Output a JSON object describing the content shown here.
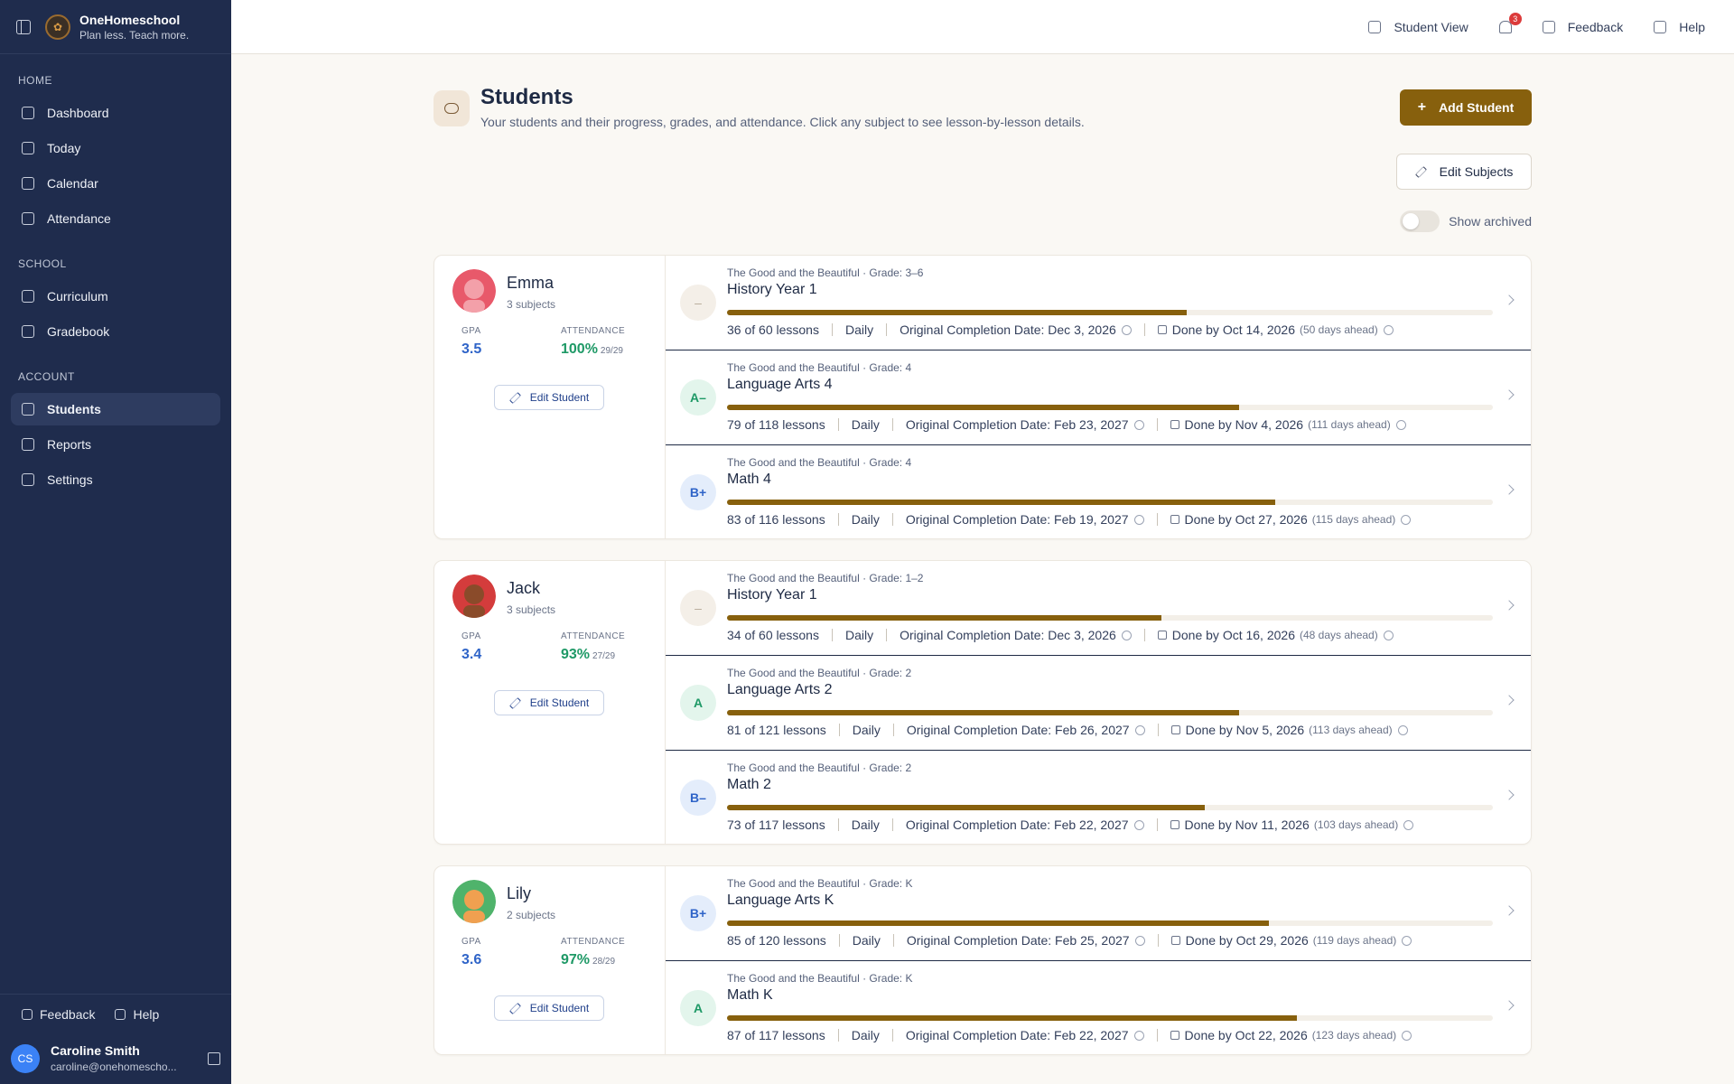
{
  "brand": {
    "name": "OneHomeschool",
    "tagline": "Plan less. Teach more."
  },
  "nav": {
    "home_title": "HOME",
    "home": [
      {
        "label": "Dashboard"
      },
      {
        "label": "Today"
      },
      {
        "label": "Calendar"
      },
      {
        "label": "Attendance"
      }
    ],
    "school_title": "SCHOOL",
    "school": [
      {
        "label": "Curriculum"
      },
      {
        "label": "Gradebook"
      }
    ],
    "account_title": "ACCOUNT",
    "account": [
      {
        "label": "Students"
      },
      {
        "label": "Reports"
      },
      {
        "label": "Settings"
      }
    ]
  },
  "sidebar_footer": {
    "feedback": "Feedback",
    "help": "Help"
  },
  "user": {
    "initials": "CS",
    "name": "Caroline Smith",
    "email": "caroline@onehomescho..."
  },
  "topbar": {
    "student_view": "Student View",
    "notif_count": "3",
    "feedback": "Feedback",
    "help": "Help"
  },
  "page": {
    "title": "Students",
    "subtitle": "Your students and their progress, grades, and attendance. Click any subject to see lesson-by-lesson details.",
    "add_student": "Add Student",
    "edit_subjects": "Edit Subjects",
    "show_archived": "Show archived",
    "gpa_label": "GPA",
    "attendance_label": "ATTENDANCE",
    "edit_student": "Edit Student"
  },
  "students": [
    {
      "name": "Emma",
      "subjects_count": "3 subjects",
      "gpa": "3.5",
      "attendance": "100%",
      "attendance_days": "29/29",
      "subjects": [
        {
          "meta": "The Good and the Beautiful · Grade: 3–6",
          "title": "History Year 1",
          "grade": "–",
          "progress": 0.6,
          "lessons": "36 of 60 lessons",
          "freq": "Daily",
          "orig": "Original Completion Date: Dec 3, 2026",
          "done": "Done by Oct 14, 2026",
          "ahead": "(50 days ahead)"
        },
        {
          "meta": "The Good and the Beautiful · Grade: 4",
          "title": "Language Arts 4",
          "grade": "A–",
          "progress": 0.669,
          "lessons": "79 of 118 lessons",
          "freq": "Daily",
          "orig": "Original Completion Date: Feb 23, 2027",
          "done": "Done by Nov 4, 2026",
          "ahead": "(111 days ahead)"
        },
        {
          "meta": "The Good and the Beautiful · Grade: 4",
          "title": "Math 4",
          "grade": "B+",
          "progress": 0.716,
          "lessons": "83 of 116 lessons",
          "freq": "Daily",
          "orig": "Original Completion Date: Feb 19, 2027",
          "done": "Done by Oct 27, 2026",
          "ahead": "(115 days ahead)"
        }
      ]
    },
    {
      "name": "Jack",
      "subjects_count": "3 subjects",
      "gpa": "3.4",
      "attendance": "93%",
      "attendance_days": "27/29",
      "subjects": [
        {
          "meta": "The Good and the Beautiful · Grade: 1–2",
          "title": "History Year 1",
          "grade": "–",
          "progress": 0.567,
          "lessons": "34 of 60 lessons",
          "freq": "Daily",
          "orig": "Original Completion Date: Dec 3, 2026",
          "done": "Done by Oct 16, 2026",
          "ahead": "(48 days ahead)"
        },
        {
          "meta": "The Good and the Beautiful · Grade: 2",
          "title": "Language Arts 2",
          "grade": "A",
          "progress": 0.669,
          "lessons": "81 of 121 lessons",
          "freq": "Daily",
          "orig": "Original Completion Date: Feb 26, 2027",
          "done": "Done by Nov 5, 2026",
          "ahead": "(113 days ahead)"
        },
        {
          "meta": "The Good and the Beautiful · Grade: 2",
          "title": "Math 2",
          "grade": "B–",
          "progress": 0.624,
          "lessons": "73 of 117 lessons",
          "freq": "Daily",
          "orig": "Original Completion Date: Feb 22, 2027",
          "done": "Done by Nov 11, 2026",
          "ahead": "(103 days ahead)"
        }
      ]
    },
    {
      "name": "Lily",
      "subjects_count": "2 subjects",
      "gpa": "3.6",
      "attendance": "97%",
      "attendance_days": "28/29",
      "subjects": [
        {
          "meta": "The Good and the Beautiful · Grade: K",
          "title": "Language Arts K",
          "grade": "B+",
          "progress": 0.708,
          "lessons": "85 of 120 lessons",
          "freq": "Daily",
          "orig": "Original Completion Date: Feb 25, 2027",
          "done": "Done by Oct 29, 2026",
          "ahead": "(119 days ahead)"
        },
        {
          "meta": "The Good and the Beautiful · Grade: K",
          "title": "Math K",
          "grade": "A",
          "progress": 0.744,
          "lessons": "87 of 117 lessons",
          "freq": "Daily",
          "orig": "Original Completion Date: Feb 22, 2027",
          "done": "Done by Oct 22, 2026",
          "ahead": "(123 days ahead)"
        }
      ]
    }
  ]
}
